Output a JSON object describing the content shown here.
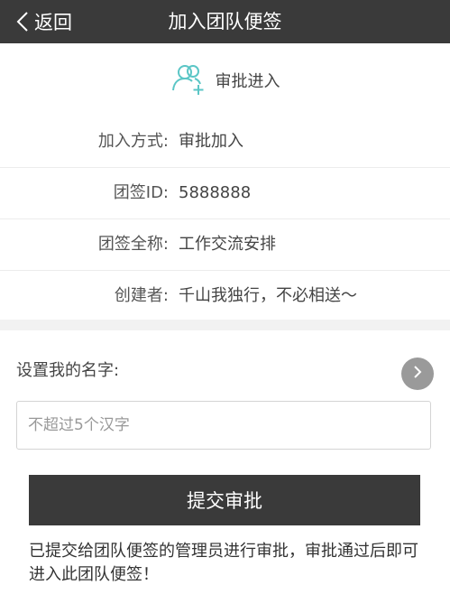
{
  "topbar": {
    "back_label": "返回",
    "title": "加入团队便签"
  },
  "header": {
    "icon": "add-user-icon",
    "label": "审批进入",
    "accent_color": "#5bc6c6"
  },
  "info": {
    "rows": [
      {
        "key": "加入方式:",
        "value": "审批加入"
      },
      {
        "key": "团签ID:",
        "value": "5888888"
      },
      {
        "key": "团签全称:",
        "value": "工作交流安排"
      },
      {
        "key": "创建者:",
        "value": "千山我独行，不必相送～"
      }
    ]
  },
  "name_section": {
    "label": "设置我的名字:",
    "placeholder": "不超过5个汉字",
    "value": ""
  },
  "submit_label": "提交审批",
  "note": "已提交给团队便签的管理员进行审批，审批通过后即可进入此团队便签！"
}
